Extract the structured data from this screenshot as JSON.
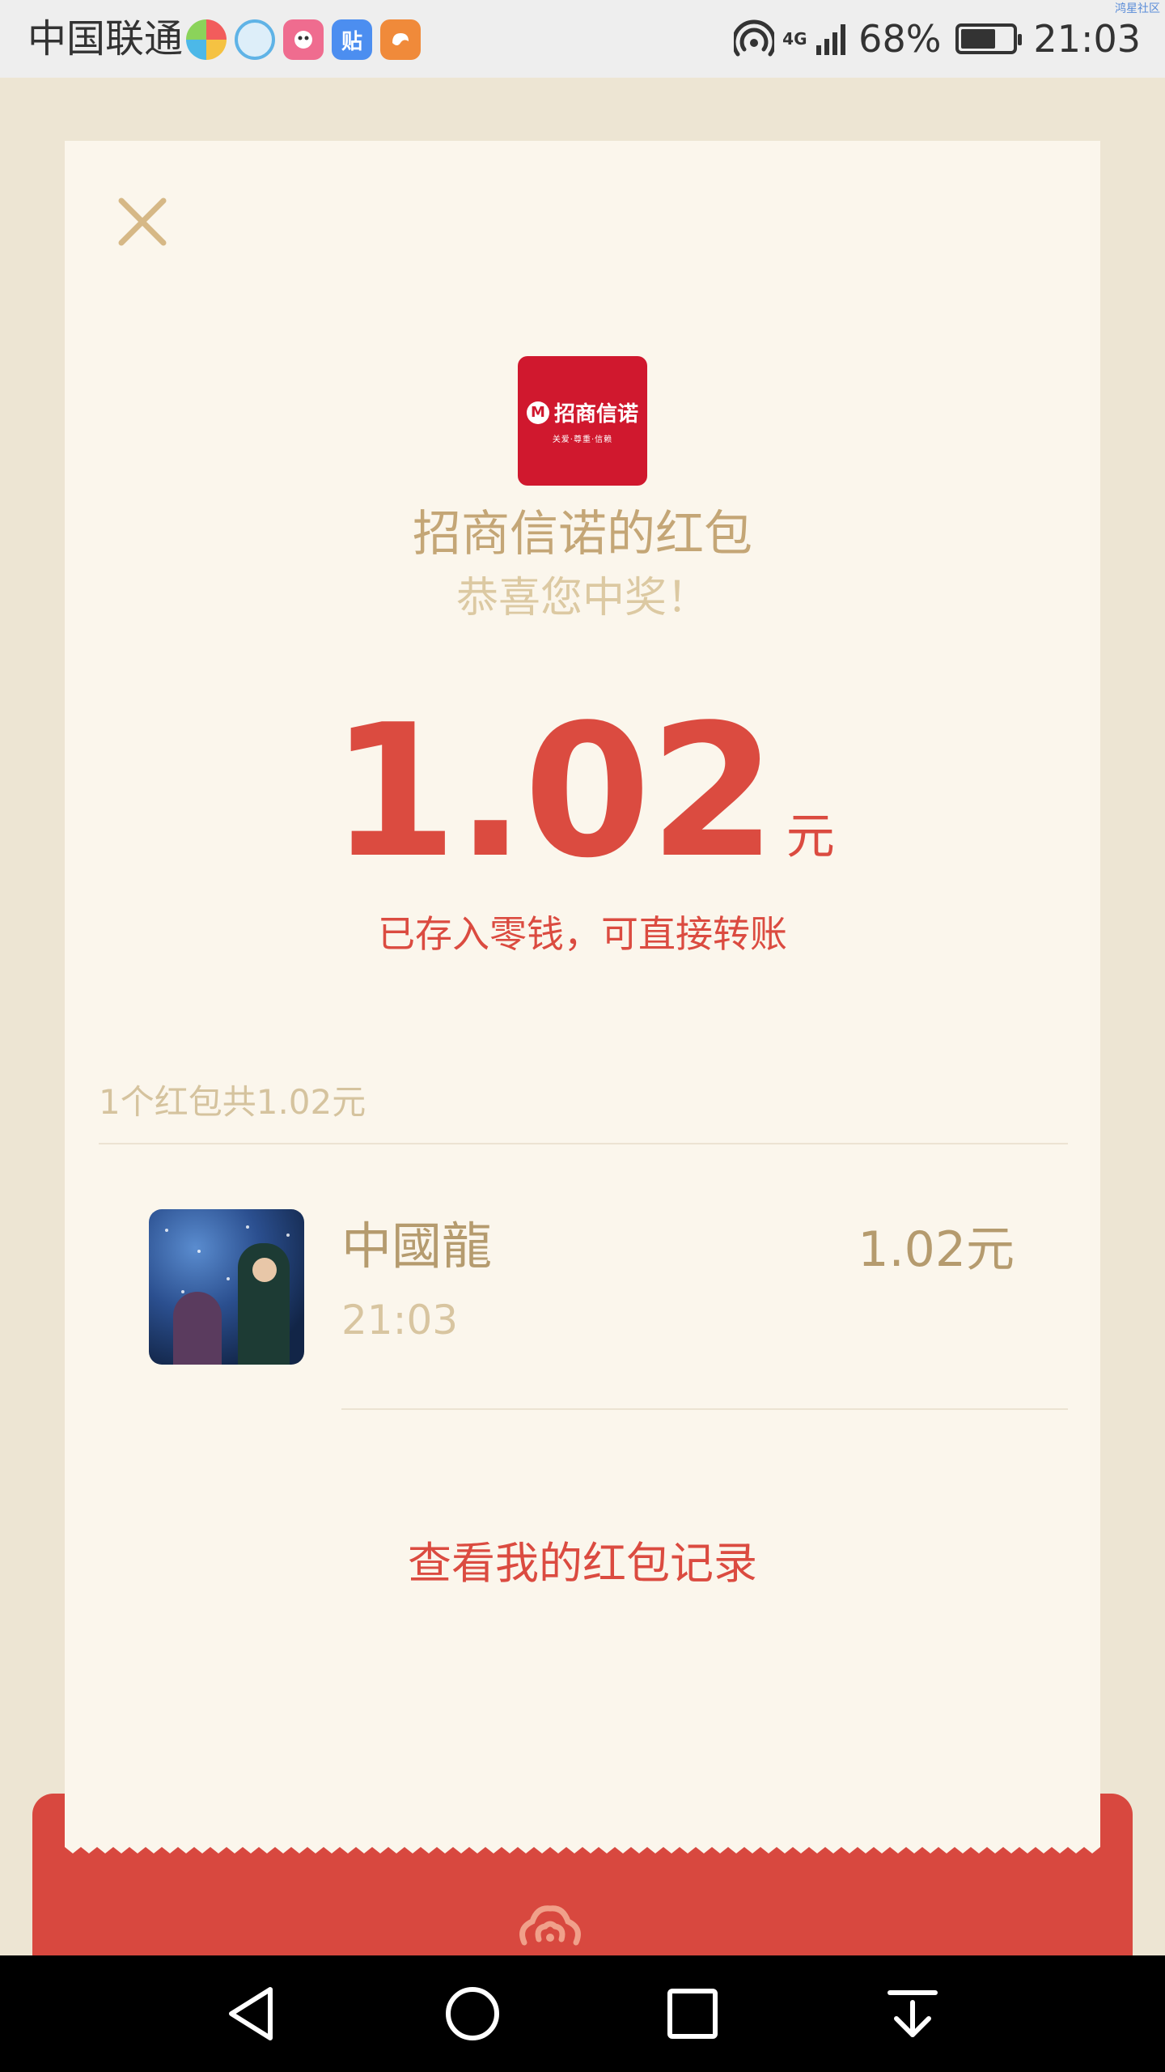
{
  "status_bar": {
    "carrier": "中国联通",
    "network": "4G",
    "battery": "68%",
    "battery_level": 0.68,
    "time": "21:03",
    "notification_icons": [
      "colorful-ball-icon",
      "browser-icon",
      "chat-bubble-icon",
      "tieba-icon",
      "uc-browser-icon"
    ],
    "tieba_label": "贴",
    "watermark": "鸿星社区"
  },
  "card": {
    "logo": {
      "name": "招商信诺",
      "mark": "M",
      "slogan": "关爱·尊重·信赖"
    },
    "sender_title": "招商信诺的红包",
    "congrats": "恭喜您中奖！",
    "amount": "1.02",
    "amount_unit": "元",
    "stored_note": "已存入零钱，可直接转账",
    "summary": "1个红包共1.02元",
    "records": [
      {
        "name": "中國龍",
        "time": "21:03",
        "amount": "1.02元"
      }
    ],
    "view_records": "查看我的红包记录"
  },
  "colors": {
    "red": "#db4b40",
    "gold": "#c4a676",
    "card_bg": "#fbf6ec",
    "page_bg": "#ede5d3",
    "logo_red": "#d0182e"
  }
}
